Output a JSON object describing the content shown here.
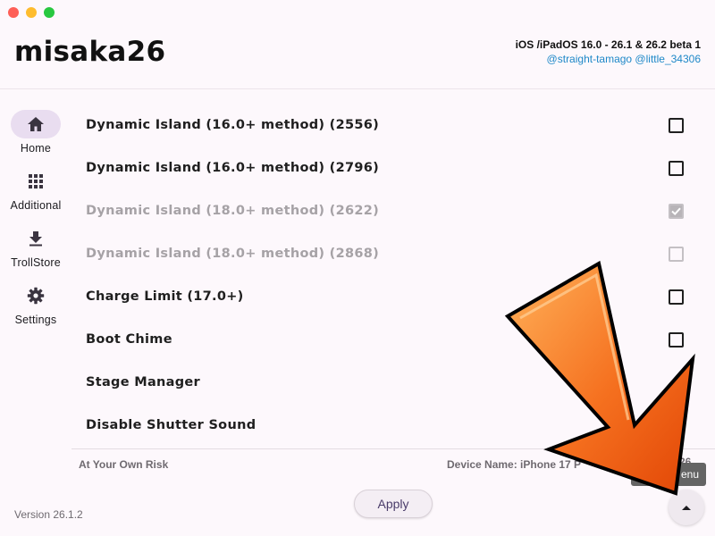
{
  "window": {
    "traffic_lights": [
      {
        "name": "close",
        "color": "#fe5f57"
      },
      {
        "name": "minimize",
        "color": "#febc2e"
      },
      {
        "name": "zoom",
        "color": "#28c840"
      }
    ]
  },
  "header": {
    "title": "misaka26",
    "compatibility": "iOS /iPadOS 16.0 - 26.1 & 26.2 beta 1",
    "credits": "@straight-tamago @little_34306"
  },
  "sidebar": {
    "items": [
      {
        "label": "Home",
        "icon": "home-icon",
        "active": true
      },
      {
        "label": "Additional",
        "icon": "grid-icon",
        "active": false
      },
      {
        "label": "TrollStore",
        "icon": "download-icon",
        "active": false
      },
      {
        "label": "Settings",
        "icon": "gear-icon",
        "active": false
      }
    ]
  },
  "tweaks": [
    {
      "label": "Dynamic Island (16.0+ method) (2556)",
      "enabled": true,
      "checked": false,
      "has_checkbox": true
    },
    {
      "label": "Dynamic Island (16.0+ method) (2796)",
      "enabled": true,
      "checked": false,
      "has_checkbox": true
    },
    {
      "label": "Dynamic Island (18.0+ method) (2622)",
      "enabled": false,
      "checked": true,
      "has_checkbox": true
    },
    {
      "label": "Dynamic Island (18.0+ method) (2868)",
      "enabled": false,
      "checked": false,
      "has_checkbox": true
    },
    {
      "label": "Charge Limit (17.0+)",
      "enabled": true,
      "checked": false,
      "has_checkbox": true
    },
    {
      "label": "Boot Chime",
      "enabled": true,
      "checked": false,
      "has_checkbox": true
    },
    {
      "label": "Stage Manager",
      "enabled": true,
      "checked": false,
      "has_checkbox": false
    },
    {
      "label": "Disable Shutter Sound",
      "enabled": true,
      "checked": false,
      "has_checkbox": false
    }
  ],
  "footer": {
    "risk": "At Your Own Risk",
    "device": "Device Name: iPhone 17 P",
    "device_tail": "26",
    "version": "Version 26.1.2",
    "apply_label": "Apply",
    "menu_tooltip": "enu"
  },
  "colors": {
    "accent": "#e9ddf0",
    "link": "#1e88c8",
    "arrow_fill": "#f26b1d"
  }
}
